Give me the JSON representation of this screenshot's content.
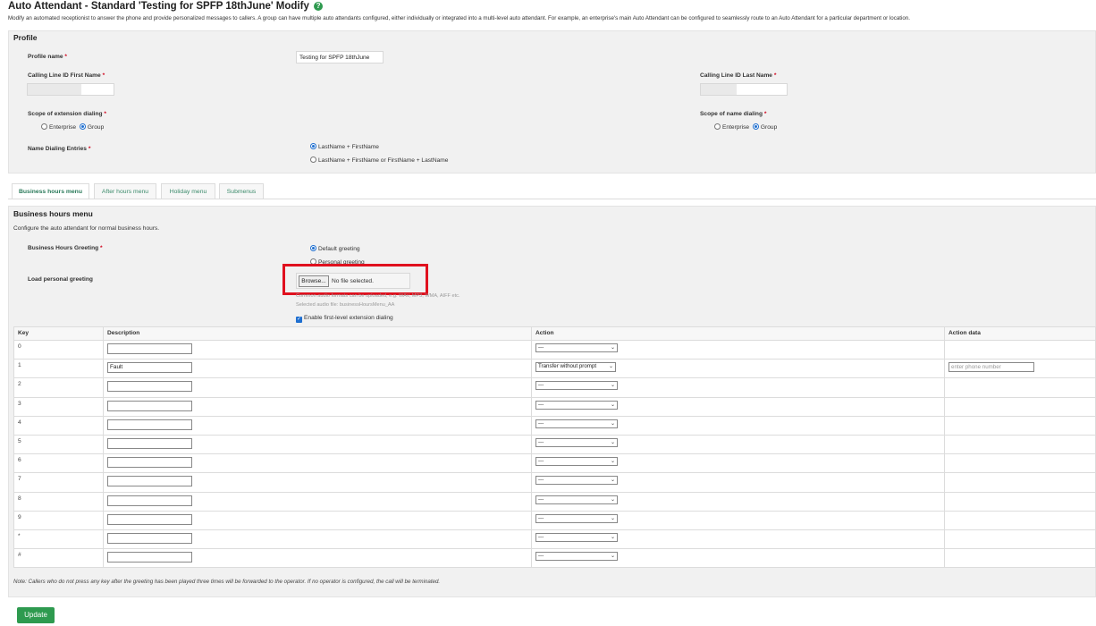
{
  "page": {
    "title": "Auto Attendant - Standard 'Testing for SPFP 18thJune' Modify",
    "help_icon": "?",
    "description": "Modify an automated receptionist to answer the phone and provide personalized messages to callers. A group can have multiple auto attendants configured, either individually or integrated into a multi-level auto attendant. For example, an enterprise's main Auto Attendant can be configured to seamlessly route to an Auto Attendant for a particular department or location."
  },
  "profile": {
    "title": "Profile",
    "profile_name_label": "Profile name",
    "profile_name_value": "Testing for SPFP 18thJune",
    "first_name_label": "Calling Line ID First Name",
    "last_name_label": "Calling Line ID Last Name",
    "scope_ext_label": "Scope of extension dialing",
    "scope_name_label": "Scope of name dialing",
    "enterprise": "Enterprise",
    "group": "Group",
    "name_dialing_label": "Name Dialing Entries",
    "name_dialing_opt1": "LastName + FirstName",
    "name_dialing_opt2": "LastName + FirstName or FirstName + LastName",
    "required_mark": "*"
  },
  "tabs": [
    "Business hours menu",
    "After hours menu",
    "Holiday menu",
    "Submenus"
  ],
  "menu": {
    "title": "Business hours menu",
    "description": "Configure the auto attendant for normal business hours.",
    "greeting_label": "Business Hours Greeting",
    "default_greeting": "Default greeting",
    "personal_greeting": "Personal greeting",
    "load_label": "Load personal greeting",
    "browse": "Browse...",
    "no_file": "No file selected.",
    "formats_hint": "Common audio formats can be uploaded, e.g. WAV, MP3, WMA, AIFF etc.",
    "selected_audio": "Selected audio file: businessHoursMenu_AA",
    "enable_ext": "Enable first-level extension dialing",
    "check_mark": "✓"
  },
  "table": {
    "headers": [
      "Key",
      "Description",
      "Action",
      "Action data"
    ],
    "rows": [
      {
        "key": "0",
        "desc": "",
        "action": "---",
        "data": ""
      },
      {
        "key": "1",
        "desc": "Fault",
        "action": "Transfer without prompt",
        "data": "enter phone number"
      },
      {
        "key": "2",
        "desc": "",
        "action": "---",
        "data": ""
      },
      {
        "key": "3",
        "desc": "",
        "action": "---",
        "data": ""
      },
      {
        "key": "4",
        "desc": "",
        "action": "---",
        "data": ""
      },
      {
        "key": "5",
        "desc": "",
        "action": "---",
        "data": ""
      },
      {
        "key": "6",
        "desc": "",
        "action": "---",
        "data": ""
      },
      {
        "key": "7",
        "desc": "",
        "action": "---",
        "data": ""
      },
      {
        "key": "8",
        "desc": "",
        "action": "---",
        "data": ""
      },
      {
        "key": "9",
        "desc": "",
        "action": "---",
        "data": ""
      },
      {
        "key": "*",
        "desc": "",
        "action": "---",
        "data": ""
      },
      {
        "key": "#",
        "desc": "",
        "action": "---",
        "data": ""
      }
    ]
  },
  "note": "Note: Callers who do not press any key after the greeting has been played three times will be forwarded to the operator. If no operator is configured, the call will be terminated.",
  "update_button": "Update"
}
